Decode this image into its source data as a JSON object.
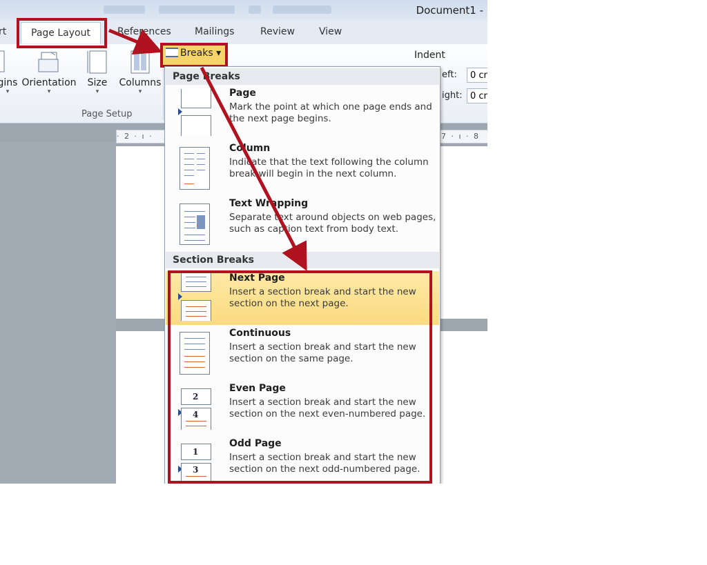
{
  "window": {
    "title": "Document1 -"
  },
  "tabs": [
    {
      "label": "rt"
    },
    {
      "label": "Page Layout"
    },
    {
      "label": "References"
    },
    {
      "label": "Mailings"
    },
    {
      "label": "Review"
    },
    {
      "label": "View"
    }
  ],
  "ribbon": {
    "page_setup": {
      "group_label": "Page Setup",
      "buttons": [
        {
          "label": "gins",
          "icon": "margins-icon"
        },
        {
          "label": "Orientation",
          "icon": "orientation-icon"
        },
        {
          "label": "Size",
          "icon": "size-icon"
        },
        {
          "label": "Columns",
          "icon": "columns-icon"
        }
      ],
      "breaks_label": "Breaks"
    },
    "indent": {
      "label": "Indent",
      "left_label": "eft:",
      "left_value": "0 cm",
      "right_label": "ight:",
      "right_value": "0 cm"
    },
    "ruler": "· 2 · ı ·",
    "ruler_right": "7 · ı · 8"
  },
  "menu": {
    "page_breaks_header": "Page Breaks",
    "section_breaks_header": "Section Breaks",
    "page_breaks": [
      {
        "title": "Page",
        "desc": "Mark the point at which one page ends and the next page begins."
      },
      {
        "title": "Column",
        "desc": "Indicate that the text following the column break will begin in the next column."
      },
      {
        "title": "Text Wrapping",
        "desc": "Separate text around objects on web pages, such as caption text from body text."
      }
    ],
    "section_breaks": [
      {
        "title": "Next Page",
        "desc": "Insert a section break and start the new section on the next page.",
        "highlighted": true
      },
      {
        "title": "Continuous",
        "desc": "Insert a section break and start the new section on the same page."
      },
      {
        "title": "Even Page",
        "desc": "Insert a section break and start the new section on the next even-numbered page.",
        "num1": "2",
        "num2": "4"
      },
      {
        "title": "Odd Page",
        "desc": "Insert a section break and start the new section on the next odd-numbered page.",
        "num1": "1",
        "num2": "3"
      }
    ]
  },
  "colors": {
    "annotation_red": "#b0121f",
    "highlight": "#fbdb80"
  }
}
